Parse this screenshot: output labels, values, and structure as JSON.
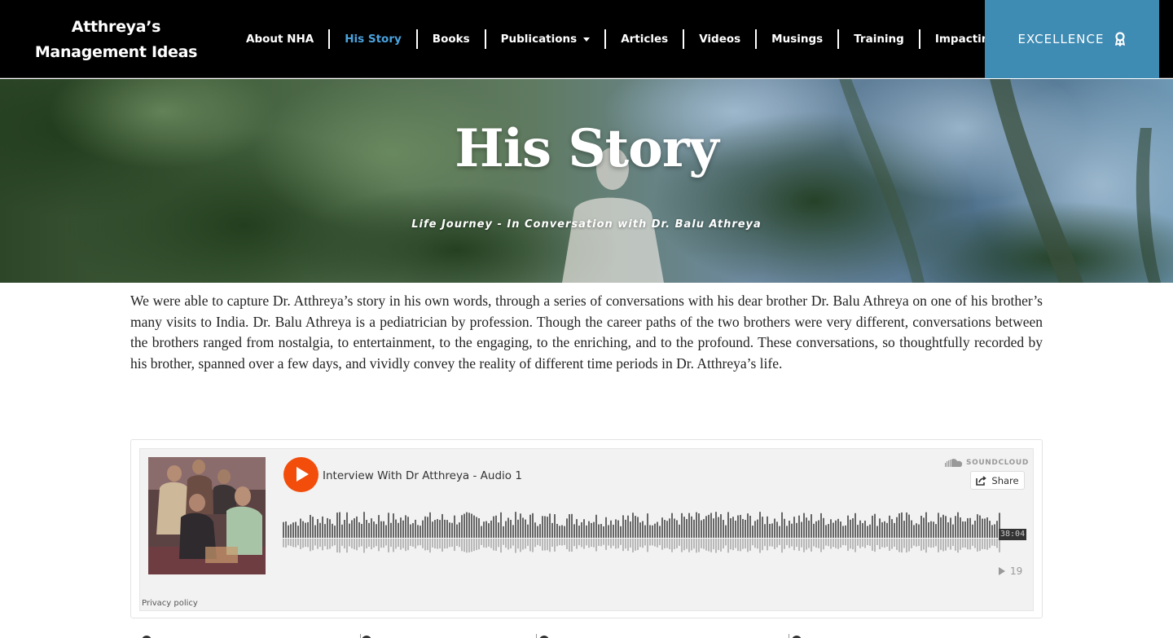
{
  "brand": {
    "line1": "Atthreya’s",
    "line2": "Management Ideas"
  },
  "nav": {
    "items": [
      {
        "label": "About NHA",
        "active": false
      },
      {
        "label": "His Story",
        "active": true
      },
      {
        "label": "Books",
        "active": false
      },
      {
        "label": "Publications",
        "active": false,
        "dropdown": true
      },
      {
        "label": "Articles",
        "active": false
      },
      {
        "label": "Videos",
        "active": false
      },
      {
        "label": "Musings",
        "active": false
      },
      {
        "label": "Training",
        "active": false
      },
      {
        "label": "Impacting Lives",
        "active": false
      }
    ],
    "active_color": "#4aa3df"
  },
  "cta": {
    "label": "EXCELLENCE",
    "icon": "award-ribbon-icon",
    "color": "#3e8bb3"
  },
  "hero": {
    "title": "His Story",
    "subtitle": "Life Journey - In Conversation with Dr. Balu Athreya"
  },
  "intro": {
    "text": "We were able to capture Dr. Atthreya’s story in his own words, through a series of conversations with his dear  brother Dr. Balu Athreya on one of his brother’s many visits to India. Dr. Balu Athreya is a pediatrician by profession. Though the career paths of the two brothers were very different, conversations between the brothers ranged from nostalgia, to entertainment,  to the engaging, to the enriching, and to the profound. These conversations, so thoughtfully recorded by his brother,  spanned over a few days, and vividly convey the reality of different time periods  in Dr. Atthreya’s life."
  },
  "player": {
    "track_title": "Interview With Dr Atthreya - Audio 1",
    "brand": "SOUNDCLOUD",
    "share_label": "Share",
    "duration": "38:04",
    "play_count": "19",
    "privacy_label": "Privacy policy",
    "accent_color": "#f24d0a"
  }
}
